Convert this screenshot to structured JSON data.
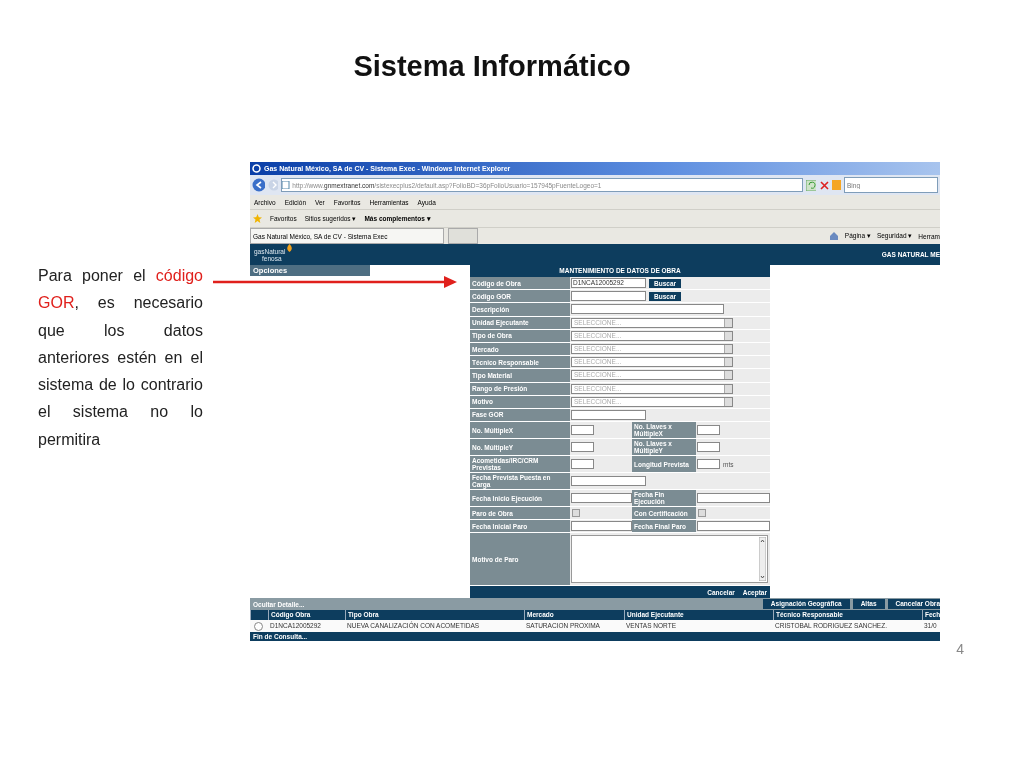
{
  "slide": {
    "title": "Sistema Informático",
    "page_number": "4"
  },
  "note": {
    "parts": [
      {
        "text": "Para poner el ",
        "highlighted": false
      },
      {
        "text": "código GOR",
        "highlighted": true
      },
      {
        "text": ", es necesario que los datos anteriores estén en el sistema de lo contrario el sistema no lo permitira",
        "highlighted": false
      }
    ]
  },
  "browser": {
    "title": "Gas Natural México, SA de CV - Sistema Exec - Windows Internet Explorer",
    "address": {
      "prefix": "http://www.",
      "domain": "gnmextranet.com",
      "path": "/sistexecplus2/default.asp?FolioBD=36pFolioUsuario=157945pFuenteLogeo=1"
    },
    "search": {
      "placeholder": "Bing"
    },
    "menu": [
      "Archivo",
      "Edición",
      "Ver",
      "Favoritos",
      "Herramientas",
      "Ayuda"
    ],
    "favorites": {
      "label": "Favoritos",
      "links": [
        {
          "text": "Sitios sugeridos ▾",
          "bold": false
        },
        {
          "text": "Más complementos ▾",
          "bold": true
        }
      ]
    },
    "tab": {
      "title": "Gas Natural México, SA de CV - Sistema Exec"
    },
    "commands": [
      "Página ▾",
      "Seguridad ▾",
      "Herram"
    ]
  },
  "app": {
    "logo": [
      "gasNatural",
      "fenosa"
    ],
    "company": "GAS NATURAL ME",
    "sidebar": {
      "title": "Opciones"
    },
    "form": {
      "title": "MANTENIMIENTO DE DATOS DE OBRA",
      "rows": [
        {
          "fields": [
            {
              "label": "Código de Obra",
              "kind": "field",
              "value": "D1NCA12005292",
              "button": "Buscar"
            }
          ]
        },
        {
          "fields": [
            {
              "label": "Código GOR",
              "kind": "field",
              "button": "Buscar"
            }
          ]
        },
        {
          "fields": [
            {
              "label": "Descripción",
              "kind": "long"
            }
          ]
        },
        {
          "fields": [
            {
              "label": "Unidad Ejecutante",
              "kind": "select",
              "placeholder": "SELECCIONE..."
            }
          ]
        },
        {
          "fields": [
            {
              "label": "Tipo de Obra",
              "kind": "select",
              "placeholder": "SELECCIONE..."
            }
          ]
        },
        {
          "fields": [
            {
              "label": "Mercado",
              "kind": "select",
              "placeholder": "SELECCIONE..."
            }
          ]
        },
        {
          "fields": [
            {
              "label": "Técnico Responsable",
              "kind": "select",
              "placeholder": "SELECCIONE..."
            }
          ]
        },
        {
          "fields": [
            {
              "label": "Tipo Material",
              "kind": "select",
              "placeholder": "SELECCIONE..."
            }
          ]
        },
        {
          "fields": [
            {
              "label": "Rango de Presión",
              "kind": "select",
              "placeholder": "SELECCIONE..."
            }
          ]
        },
        {
          "fields": [
            {
              "label": "Motivo",
              "kind": "select",
              "placeholder": "SELECCIONE..."
            }
          ]
        },
        {
          "fields": [
            {
              "label": "Fase GOR",
              "kind": "field"
            }
          ]
        },
        {
          "fields": [
            {
              "label": "No. MúltipleX",
              "kind": "short"
            },
            {
              "label": "No. Llaves x MúltipleX",
              "kind": "short"
            }
          ]
        },
        {
          "fields": [
            {
              "label": "No. MúltipleY",
              "kind": "short"
            },
            {
              "label": "No. Llaves x MúltipleY",
              "kind": "short"
            }
          ]
        },
        {
          "fields": [
            {
              "label": "Acometidas/IRC/CRM Previstas",
              "kind": "short"
            },
            {
              "label": "Longitud Prevista",
              "kind": "short",
              "unit": "mts"
            }
          ]
        },
        {
          "fields": [
            {
              "label": "Fecha Prevista Puesta en Carga",
              "kind": "field"
            }
          ]
        },
        {
          "fields": [
            {
              "label": "Fecha Inicio Ejecución",
              "kind": "field"
            },
            {
              "label": "Fecha Fin Ejecución",
              "kind": "field"
            }
          ]
        },
        {
          "fields": [
            {
              "label": "Paro de Obra",
              "kind": "check",
              "checked": false
            },
            {
              "label": "Con Certificación",
              "kind": "check",
              "checked": false
            }
          ]
        },
        {
          "fields": [
            {
              "label": "Fecha Inicial Paro",
              "kind": "field"
            },
            {
              "label": "Fecha Final Paro",
              "kind": "field"
            }
          ]
        },
        {
          "fields": [
            {
              "label": "Motivo de Paro",
              "kind": "memo"
            }
          ]
        }
      ],
      "buttons": [
        "Cancelar",
        "Aceptar"
      ]
    },
    "detail": {
      "toggle": "Ocultar Detalle...",
      "buttons": [
        "Asignación Geográfica",
        "Altas",
        "Cancelar Obra"
      ],
      "columns": [
        "Código Obra",
        "Tipo Obra",
        "Mercado",
        "Unidad Ejecutante",
        "Técnico Responsable",
        "Fech"
      ],
      "rows": [
        {
          "selected": false,
          "cells": [
            "D1NCA12005292",
            "NUEVA CANALIZACIÓN CON ACOMETIDAS",
            "SATURACION PROXIMA",
            "VENTAS NORTE",
            "CRISTOBAL RODRIGUEZ SANCHEZ.",
            "31/0"
          ]
        }
      ],
      "footer": "Fin de Consulta..."
    }
  }
}
